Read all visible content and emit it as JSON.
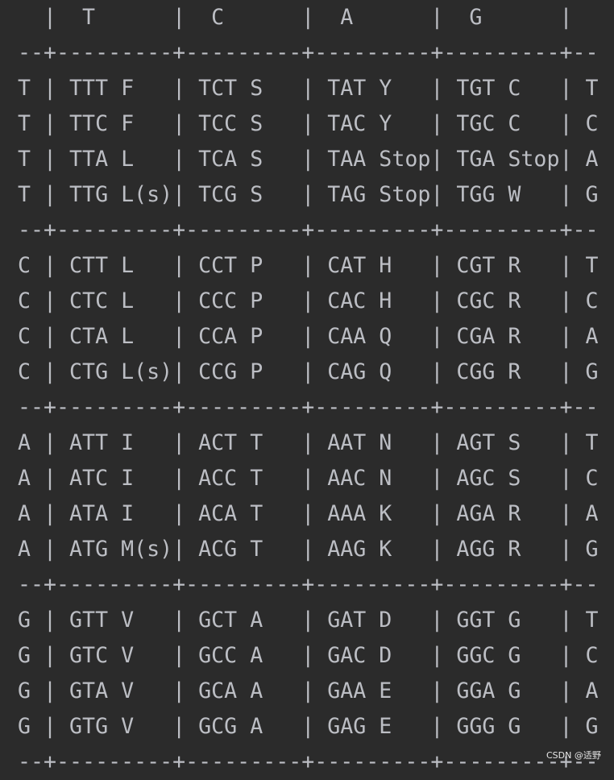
{
  "table": {
    "header": "  |  T      |  C      |  A      |  G      |",
    "separator": "--+---------+---------+---------+---------+--",
    "groups": [
      {
        "rows": [
          "T | TTT F   | TCT S   | TAT Y   | TGT C   | T",
          "T | TTC F   | TCC S   | TAC Y   | TGC C   | C",
          "T | TTA L   | TCA S   | TAA Stop| TGA Stop| A",
          "T | TTG L(s)| TCG S   | TAG Stop| TGG W   | G"
        ]
      },
      {
        "rows": [
          "C | CTT L   | CCT P   | CAT H   | CGT R   | T",
          "C | CTC L   | CCC P   | CAC H   | CGC R   | C",
          "C | CTA L   | CCA P   | CAA Q   | CGA R   | A",
          "C | CTG L(s)| CCG P   | CAG Q   | CGG R   | G"
        ]
      },
      {
        "rows": [
          "A | ATT I   | ACT T   | AAT N   | AGT S   | T",
          "A | ATC I   | ACC T   | AAC N   | AGC S   | C",
          "A | ATA I   | ACA T   | AAA K   | AGA R   | A",
          "A | ATG M(s)| ACG T   | AAG K   | AGG R   | G"
        ]
      },
      {
        "rows": [
          "G | GTT V   | GCT A   | GAT D   | GGT G   | T",
          "G | GTC V   | GCC A   | GAC D   | GGC G   | C",
          "G | GTA V   | GCA A   | GAA E   | GGA G   | A",
          "G | GTG V   | GCG A   | GAG E   | GGG G   | G"
        ]
      }
    ]
  },
  "watermark": "CSDN @适野",
  "colors": {
    "background": "#2b2b2b",
    "text": "#bcbec4"
  }
}
